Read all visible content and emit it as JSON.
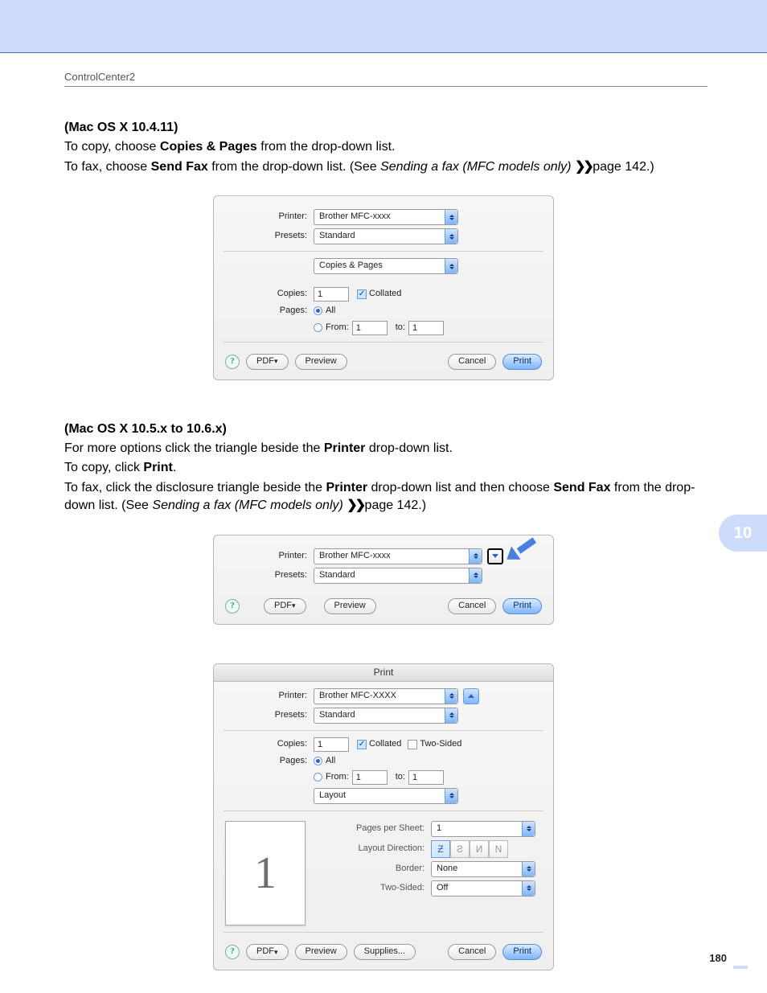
{
  "doc": {
    "header": "ControlCenter2",
    "page_number": "180",
    "section_tab": "10"
  },
  "p1": {
    "heading": "(Mac OS X 10.4.11)",
    "l1a": "To copy, choose ",
    "l1b": "Copies & Pages",
    "l1c": " from the drop-down list.",
    "l2a": "To fax, choose ",
    "l2b": "Send Fax",
    "l2c": " from the drop-down list. (See ",
    "l2d": "Sending a fax (MFC models only)",
    "l2e": " page 142.)"
  },
  "p2": {
    "heading": "(Mac OS X 10.5.x to 10.6.x)",
    "l1a": "For more options click the triangle beside the ",
    "l1b": "Printer",
    "l1c": " drop-down list.",
    "l2a": "To copy, click ",
    "l2b": "Print",
    "l2c": ".",
    "l3a": "To fax, click the disclosure triangle beside the ",
    "l3b": "Printer",
    "l3c": " drop-down list and then choose ",
    "l3d": "Send Fax",
    "l3e": " from the drop-down list. (See ",
    "l3f": "Sending a fax (MFC models only)",
    "l3g": " page 142.)"
  },
  "d1": {
    "printer_lab": "Printer:",
    "printer_val": "Brother MFC-xxxx",
    "presets_lab": "Presets:",
    "presets_val": "Standard",
    "section_val": "Copies & Pages",
    "copies_lab": "Copies:",
    "copies_val": "1",
    "collated": "Collated",
    "pages_lab": "Pages:",
    "all": "All",
    "from": "From:",
    "from_val": "1",
    "to": "to:",
    "to_val": "1",
    "pdf": "PDF",
    "preview": "Preview",
    "cancel": "Cancel",
    "print": "Print"
  },
  "d2": {
    "printer_lab": "Printer:",
    "printer_val": "Brother MFC-xxxx",
    "presets_lab": "Presets:",
    "presets_val": "Standard",
    "pdf": "PDF",
    "preview": "Preview",
    "cancel": "Cancel",
    "print": "Print"
  },
  "d3": {
    "title": "Print",
    "printer_lab": "Printer:",
    "printer_val": "Brother MFC-XXXX",
    "presets_lab": "Presets:",
    "presets_val": "Standard",
    "copies_lab": "Copies:",
    "copies_val": "1",
    "collated": "Collated",
    "twosided_cb": "Two-Sided",
    "pages_lab": "Pages:",
    "all": "All",
    "from": "From:",
    "from_val": "1",
    "to": "to:",
    "to_val": "1",
    "section_val": "Layout",
    "thumb_page": "1",
    "pps_lab": "Pages per Sheet:",
    "pps_val": "1",
    "ld_lab": "Layout Direction:",
    "border_lab": "Border:",
    "border_val": "None",
    "ts_lab": "Two-Sided:",
    "ts_val": "Off",
    "pdf": "PDF",
    "preview": "Preview",
    "supplies": "Supplies...",
    "cancel": "Cancel",
    "print": "Print"
  }
}
